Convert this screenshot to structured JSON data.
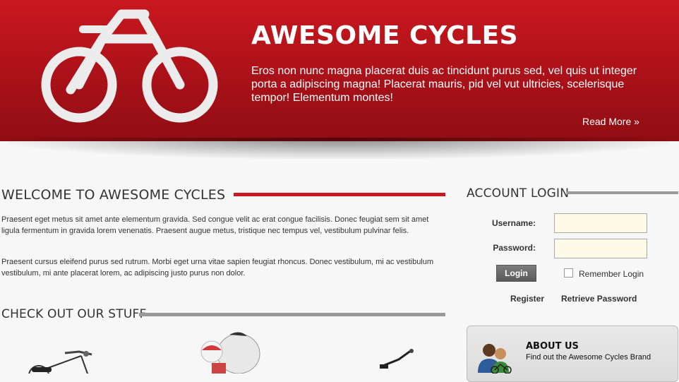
{
  "banner": {
    "title": "AWESOME CYCLES",
    "text": "Eros non nunc magna placerat duis ac tincidunt purus sed, vel quis ut integer porta a adipiscing magna! Placerat mauris, pid vel vut ultricies, scelerisque tempor! Elementum montes!",
    "read_more": "Read More »"
  },
  "welcome": {
    "title": "WELCOME TO AWESOME CYCLES",
    "paragraphs": [
      "Praesent eget metus sit amet ante elementum gravida. Sed congue velit ac erat congue facilisis. Donec feugiat sem sit amet ligula fermentum in gravida lorem venenatis. Praesent augue metus, tristique nec tempus vel, vestibulum pulvinar felis.",
      "Praesent cursus eleifend purus sed rutrum. Morbi eget urna vitae sapien feugiat rhoncus. Donec vestibulum, mi ac vestibulum vestibulum, mi ante placerat lorem, ac adipiscing justo purus non dolor."
    ]
  },
  "stuff": {
    "title": "CHECK OUT OUR STUFF"
  },
  "login": {
    "title": "ACCOUNT LOGIN",
    "username_label": "Username:",
    "password_label": "Password:",
    "username_value": "",
    "password_value": "",
    "login_button": "Login",
    "remember_label": "Remember Login",
    "remember_checked": false,
    "register_link": "Register",
    "retrieve_link": "Retrieve Password"
  },
  "about": {
    "title": "ABOUT US",
    "text": "Find out the Awesome Cycles Brand",
    "icon": "people-icon"
  },
  "colors": {
    "brand_red": "#c9181f",
    "rule_gray": "#999999",
    "field_bg": "#fdfbe8"
  }
}
